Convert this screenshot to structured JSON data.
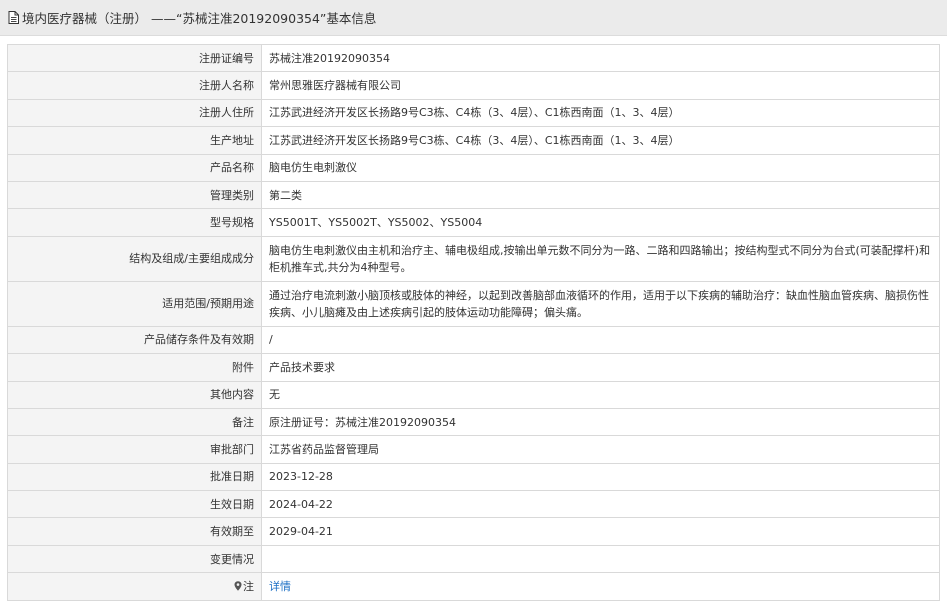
{
  "header": {
    "title": "境内医疗器械（注册） ——“苏械注准20192090354”基本信息"
  },
  "rows": [
    {
      "label": "注册证编号",
      "value": "苏械注准20192090354"
    },
    {
      "label": "注册人名称",
      "value": "常州思雅医疗器械有限公司"
    },
    {
      "label": "注册人住所",
      "value": "江苏武进经济开发区长扬路9号C3栋、C4栋（3、4层）、C1栋西南面（1、3、4层）"
    },
    {
      "label": "生产地址",
      "value": "江苏武进经济开发区长扬路9号C3栋、C4栋（3、4层）、C1栋西南面（1、3、4层）"
    },
    {
      "label": "产品名称",
      "value": "脑电仿生电刺激仪"
    },
    {
      "label": "管理类别",
      "value": "第二类"
    },
    {
      "label": "型号规格",
      "value": "YS5001T、YS5002T、YS5002、YS5004"
    },
    {
      "label": "结构及组成/主要组成成分",
      "value": "脑电仿生电刺激仪由主机和治疗主、辅电极组成,按输出单元数不同分为一路、二路和四路输出；按结构型式不同分为台式(可装配撑杆)和柜机推车式,共分为4种型号。"
    },
    {
      "label": "适用范围/预期用途",
      "value": "通过治疗电流刺激小脑顶核或肢体的神经，以起到改善脑部血液循环的作用，适用于以下疾病的辅助治疗：缺血性脑血管疾病、脑损伤性疾病、小儿脑瘫及由上述疾病引起的肢体运动功能障碍；偏头痛。"
    },
    {
      "label": "产品储存条件及有效期",
      "value": "/"
    },
    {
      "label": "附件",
      "value": "产品技术要求"
    },
    {
      "label": "其他内容",
      "value": "无"
    },
    {
      "label": "备注",
      "value": "原注册证号：苏械注准20192090354"
    },
    {
      "label": "审批部门",
      "value": "江苏省药品监督管理局"
    },
    {
      "label": "批准日期",
      "value": "2023-12-28"
    },
    {
      "label": "生效日期",
      "value": "2024-04-22"
    },
    {
      "label": "有效期至",
      "value": "2029-04-21"
    },
    {
      "label": "变更情况",
      "value": ""
    }
  ],
  "note": {
    "label": "注",
    "link": "详情"
  }
}
